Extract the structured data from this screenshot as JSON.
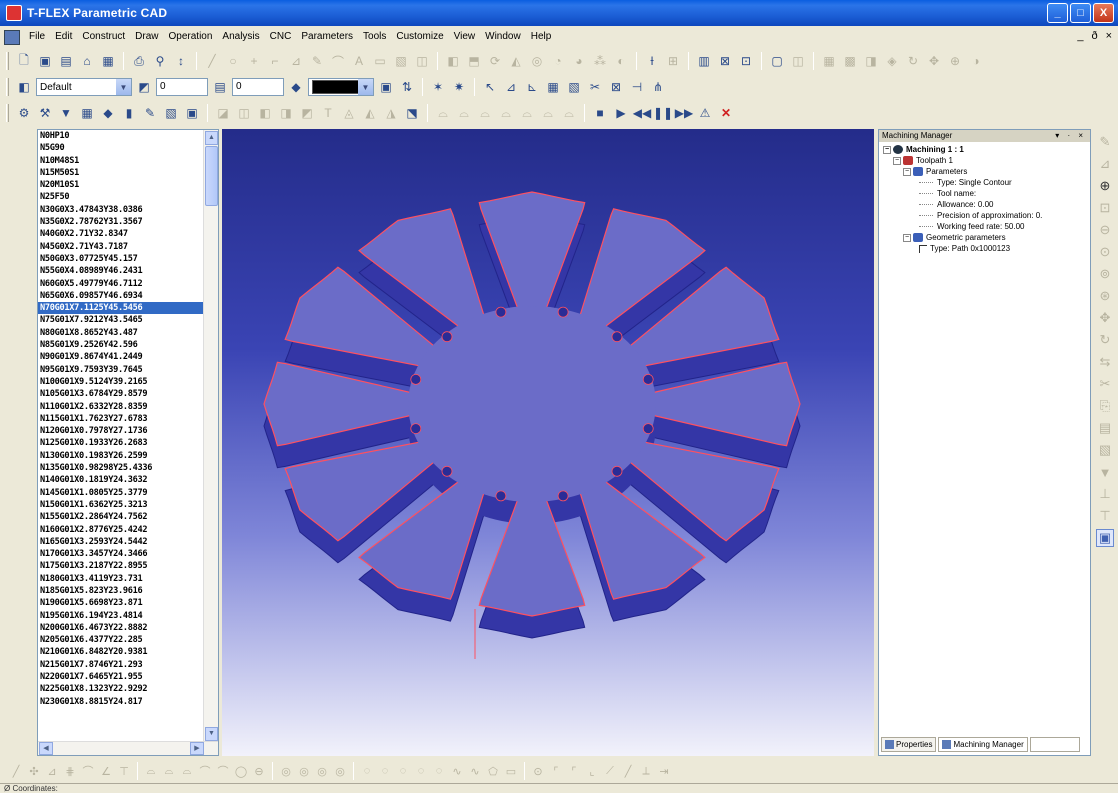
{
  "window": {
    "title": "T-FLEX Parametric CAD",
    "controls": [
      "_",
      "□",
      "X"
    ]
  },
  "menu": {
    "items": [
      "File",
      "Edit",
      "Construct",
      "Draw",
      "Operation",
      "Analysis",
      "CNC",
      "Parameters",
      "Tools",
      "Customize",
      "View",
      "Window",
      "Help"
    ],
    "mdi_controls": [
      "_",
      "ð",
      "×"
    ]
  },
  "toolbar2": {
    "layer_value": "Default",
    "width_value": "0",
    "level_value": "0"
  },
  "nc_program": {
    "selected_index": 15,
    "lines": [
      "N0HP10",
      "N5G90",
      "N10M48S1",
      "N15M50S1",
      "N20M10S1",
      "N25F50",
      "N30G0X3.47843Y38.0386",
      "N35G0X2.78762Y31.3567",
      "N40G0X2.71Y32.8347",
      "N45G0X2.71Y43.7187",
      "N50G0X3.07725Y45.157",
      "N55G0X4.08989Y46.2431",
      "N60G0X5.49779Y46.7112",
      "N65G0X6.09857Y46.6934",
      "",
      "N70G01X7.1125Y45.5456",
      "N75G01X7.9212Y43.5465",
      "N80G01X8.8652Y43.487",
      "N85G01X9.2526Y42.596",
      "N90G01X9.8674Y41.2449",
      "N95G01X9.7593Y39.7645",
      "N100G01X9.5124Y39.2165",
      "N105G01X3.6784Y29.8579",
      "N110G01X2.6332Y28.8359",
      "N115G01X1.7623Y27.6783",
      "N120G01X0.7978Y27.1736",
      "N125G01X0.1933Y26.2683",
      "N130G01X0.1983Y26.2599",
      "N135G01X0.98298Y25.4336",
      "N140G01X0.1819Y24.3632",
      "N145G01X1.0805Y25.3779",
      "N150G01X1.6362Y25.3213",
      "N155G01X2.2864Y24.7562",
      "N160G01X2.8776Y25.4242",
      "N165G01X3.2593Y24.5442",
      "N170G01X3.3457Y24.3466",
      "N175G01X3.2187Y22.8955",
      "N180G01X3.4119Y23.731",
      "N185G01X5.823Y23.9616",
      "N190G01X5.6698Y23.871",
      "N195G01X6.194Y23.4814",
      "N200G01X6.4673Y22.8882",
      "N205G01X6.4377Y22.285",
      "N210G01X6.8482Y20.9381",
      "N215G01X7.8746Y21.293",
      "N220G01X7.6465Y21.955",
      "N225G01X8.1323Y22.9292",
      "N230G01X8.8815Y24.817"
    ]
  },
  "machining_manager": {
    "header": "Machining Manager",
    "tree": {
      "root": "Machining 1 : 1",
      "toolpath": "Toolpath 1",
      "parameters": "Parameters",
      "type": "Type: Single Contour",
      "tool_name": "Tool name:",
      "allowance": "Allowance: 0.00",
      "precision": "Precision of approximation: 0.",
      "feed_rate": "Working feed rate: 50.00",
      "geometric": "Geometric parameters",
      "path_type": "Type: Path 0x1000123"
    },
    "tabs": [
      "Properties",
      "Machining Manager"
    ]
  },
  "statusbar": {
    "text": "Ø  Coordinates:"
  },
  "colors": {
    "title_bar": "#1c5fd6",
    "selection": "#316ac5",
    "model_top": "#6b6cc8",
    "model_wall": "#3436a6",
    "contour": "#ff5060"
  }
}
